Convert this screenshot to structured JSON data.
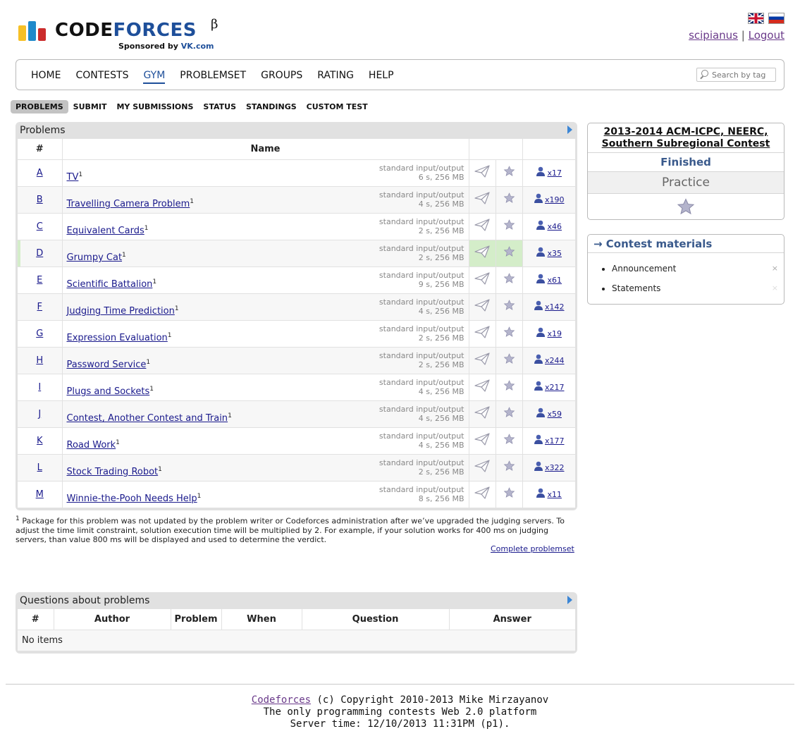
{
  "brand": {
    "word_a": "CODE",
    "word_b": "FORCES",
    "beta": "β",
    "sponsor_prefix": "Sponsored by ",
    "sponsor_name": "VK.com"
  },
  "user": {
    "name": "scipianus",
    "separator": "|",
    "logout": "Logout"
  },
  "nav": [
    "HOME",
    "CONTESTS",
    "GYM",
    "PROBLEMSET",
    "GROUPS",
    "RATING",
    "HELP"
  ],
  "search": {
    "placeholder": "Search by tag"
  },
  "subnav": [
    "PROBLEMS",
    "SUBMIT",
    "MY SUBMISSIONS",
    "STATUS",
    "STANDINGS",
    "CUSTOM TEST"
  ],
  "problems": {
    "caption": "Problems",
    "headers": [
      "#",
      "Name"
    ],
    "io": "standard input/output",
    "rows": [
      {
        "idx": "A",
        "name": "TV",
        "sup": "1",
        "limits": "6 s, 256 MB",
        "count": "x17"
      },
      {
        "idx": "B",
        "name": "Travelling Camera Problem",
        "sup": "1",
        "limits": "4 s, 256 MB",
        "count": "x190"
      },
      {
        "idx": "C",
        "name": "Equivalent Cards",
        "sup": "1",
        "limits": "2 s, 256 MB",
        "count": "x46"
      },
      {
        "idx": "D",
        "name": "Grumpy Cat",
        "sup": "1",
        "limits": "2 s, 256 MB",
        "count": "x35"
      },
      {
        "idx": "E",
        "name": "Scientific Battalion",
        "sup": "1",
        "limits": "9 s, 256 MB",
        "count": "x61"
      },
      {
        "idx": "F",
        "name": "Judging Time Prediction",
        "sup": "1",
        "limits": "4 s, 256 MB",
        "count": "x142"
      },
      {
        "idx": "G",
        "name": "Expression Evaluation",
        "sup": "1",
        "limits": "2 s, 256 MB",
        "count": "x19"
      },
      {
        "idx": "H",
        "name": "Password Service",
        "sup": "1",
        "limits": "2 s, 256 MB",
        "count": "x244"
      },
      {
        "idx": "I",
        "name": "Plugs and Sockets",
        "sup": "1",
        "limits": "4 s, 256 MB",
        "count": "x217"
      },
      {
        "idx": "J",
        "name": "Contest, Another Contest and Train",
        "sup": "1",
        "limits": "4 s, 256 MB",
        "count": "x59"
      },
      {
        "idx": "K",
        "name": "Road Work",
        "sup": "1",
        "limits": "4 s, 256 MB",
        "count": "x177"
      },
      {
        "idx": "L",
        "name": "Stock Trading Robot",
        "sup": "1",
        "limits": "2 s, 256 MB",
        "count": "x322"
      },
      {
        "idx": "M",
        "name": "Winnie-the-Pooh Needs Help",
        "sup": "1",
        "limits": "8 s, 256 MB",
        "count": "x11"
      }
    ]
  },
  "footnote": {
    "mark": "1",
    "text": " Package for this problem was not updated by the problem writer or Codeforces administration after we’ve upgraded the judging servers. To adjust the time limit constraint, solution execution time will be multiplied by 2. For example, if your solution works for 400 ms on judging servers, than value 800 ms will be displayed and used to determine the verdict."
  },
  "complete_problemset": "Complete problemset",
  "questions": {
    "caption": "Questions about problems",
    "headers": [
      "#",
      "Author",
      "Problem",
      "When",
      "Question",
      "Answer"
    ],
    "empty": "No items"
  },
  "contest": {
    "title": "2013-2014 ACM-ICPC, NEERC, Southern Subregional Contest",
    "status": "Finished",
    "phase": "Practice"
  },
  "materials": {
    "heading": "→ Contest materials",
    "items": [
      {
        "label": "Announcement",
        "x": "×"
      },
      {
        "label": "Statements",
        "x": "×"
      }
    ]
  },
  "footer": {
    "link": "Codeforces",
    "copyright": " (c) Copyright 2010-2013 Mike Mirzayanov",
    "line2": "The only programming contests Web 2.0 platform",
    "line3": "Server time: 12/10/2013 11:31PM (p1)."
  },
  "colors": {
    "accent": "#1e4f9a",
    "link": "#1a1a8c",
    "accepted": "#d4edc9"
  }
}
